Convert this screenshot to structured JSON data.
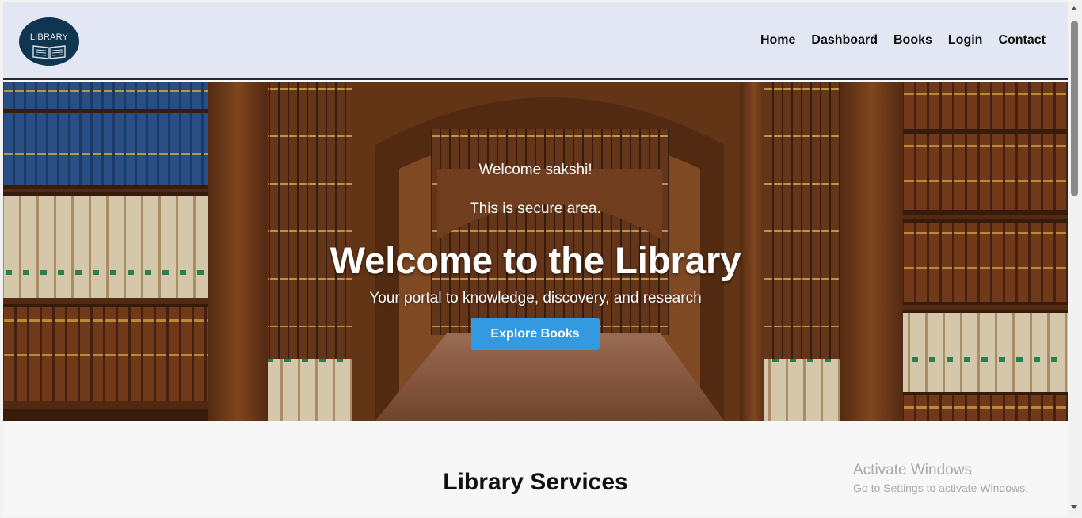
{
  "logo": {
    "text": "LIBRARY",
    "icon": "book-icon"
  },
  "nav": {
    "items": [
      {
        "label": "Home"
      },
      {
        "label": "Dashboard"
      },
      {
        "label": "Books"
      },
      {
        "label": "Login"
      },
      {
        "label": "Contact"
      }
    ]
  },
  "hero": {
    "welcome_user": "Welcome sakshi!",
    "secure_text": "This is secure area.",
    "title": "Welcome to the Library",
    "subtitle": "Your portal to knowledge, discovery, and research",
    "button_label": "Explore Books"
  },
  "services": {
    "title": "Library Services"
  },
  "watermark": {
    "line1": "Activate Windows",
    "line2": "Go to Settings to activate Windows."
  },
  "colors": {
    "navbar_bg": "#e3e7f3",
    "button_bg": "#3399e0",
    "logo_bg": "#0f3550"
  }
}
